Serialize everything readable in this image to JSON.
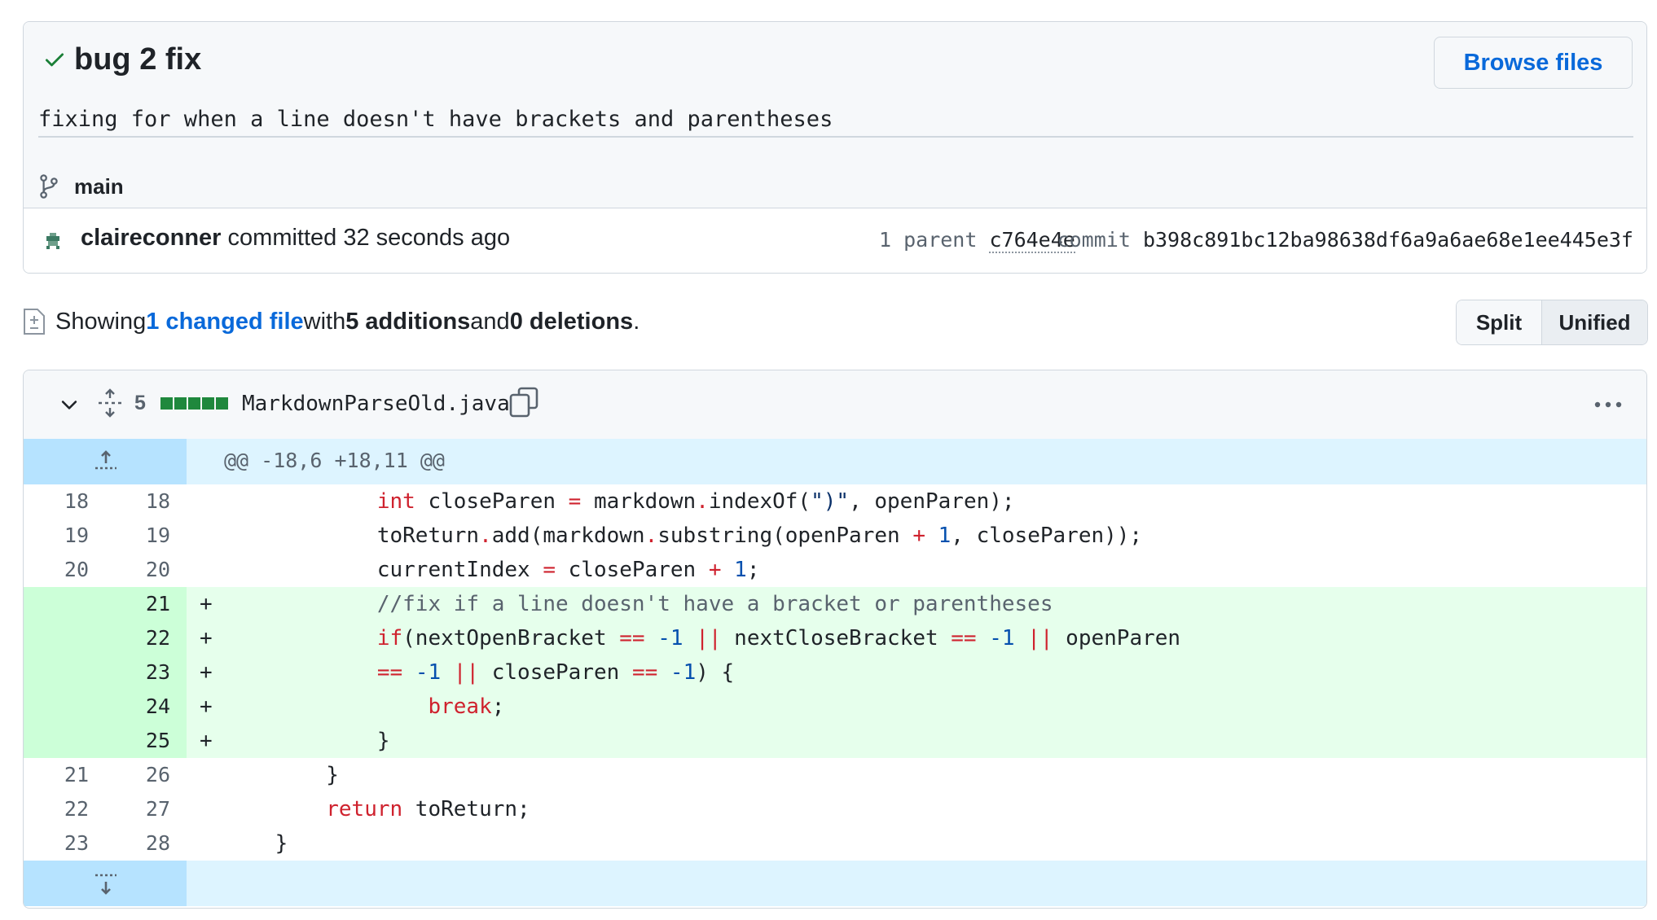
{
  "commit": {
    "title": "bug 2 fix",
    "description": "fixing for when a line doesn't have brackets and parentheses",
    "browse_label": "Browse files",
    "branch": "main",
    "author": "claireconner",
    "committed_text": " committed 32 seconds ago",
    "parent_label": "1 parent ",
    "parent_hash": "c764e4e",
    "commit_label": "commit ",
    "commit_hash": "b398c891bc12ba98638df6a9a6ae68e1ee445e3f"
  },
  "summary": {
    "prefix": "Showing ",
    "changed_link": "1 changed file",
    "with_text": " with ",
    "additions": "5 additions",
    "and_text": " and ",
    "deletions": "0 deletions",
    "period": "."
  },
  "view_toggle": {
    "split": "Split",
    "unified": "Unified"
  },
  "file": {
    "change_count": "5",
    "name": "MarkdownParseOld.java",
    "hunk_header": "@@ -18,6 +18,11 @@"
  },
  "diff_lines": [
    {
      "type": "ctx",
      "old": "18",
      "new": "18",
      "marker": "",
      "code": "            int closeParen = markdown.indexOf(\")\", openParen);"
    },
    {
      "type": "ctx",
      "old": "19",
      "new": "19",
      "marker": "",
      "code": "            toReturn.add(markdown.substring(openParen + 1, closeParen));"
    },
    {
      "type": "ctx",
      "old": "20",
      "new": "20",
      "marker": "",
      "code": "            currentIndex = closeParen + 1;"
    },
    {
      "type": "add",
      "old": "",
      "new": "21",
      "marker": "+",
      "code": "            //fix if a line doesn't have a bracket or parentheses"
    },
    {
      "type": "add",
      "old": "",
      "new": "22",
      "marker": "+",
      "code": "            if(nextOpenBracket == -1 || nextCloseBracket == -1 || openParen"
    },
    {
      "type": "add",
      "old": "",
      "new": "23",
      "marker": "+",
      "code": "            == -1 || closeParen == -1) {"
    },
    {
      "type": "add",
      "old": "",
      "new": "24",
      "marker": "+",
      "code": "                break;"
    },
    {
      "type": "add",
      "old": "",
      "new": "25",
      "marker": "+",
      "code": "            }"
    },
    {
      "type": "ctx",
      "old": "21",
      "new": "26",
      "marker": "",
      "code": "        }"
    },
    {
      "type": "ctx",
      "old": "22",
      "new": "27",
      "marker": "",
      "code": "        return toReturn;"
    },
    {
      "type": "ctx",
      "old": "23",
      "new": "28",
      "marker": "",
      "code": "    }"
    }
  ],
  "colors": {
    "link": "#0969da",
    "added_bg": "#e6ffec",
    "added_gutter": "#ccffd8",
    "hunk_bg": "#ddf4ff",
    "hunk_gutter": "#b6e3ff",
    "keyword": "#cf222e",
    "number": "#0550ae"
  },
  "icons": [
    "check-icon",
    "branch-icon",
    "avatar",
    "file-diff-icon",
    "chevron-down-icon",
    "expand-all-icon",
    "copy-icon",
    "kebab-menu-icon",
    "expand-up-icon",
    "expand-down-icon"
  ]
}
